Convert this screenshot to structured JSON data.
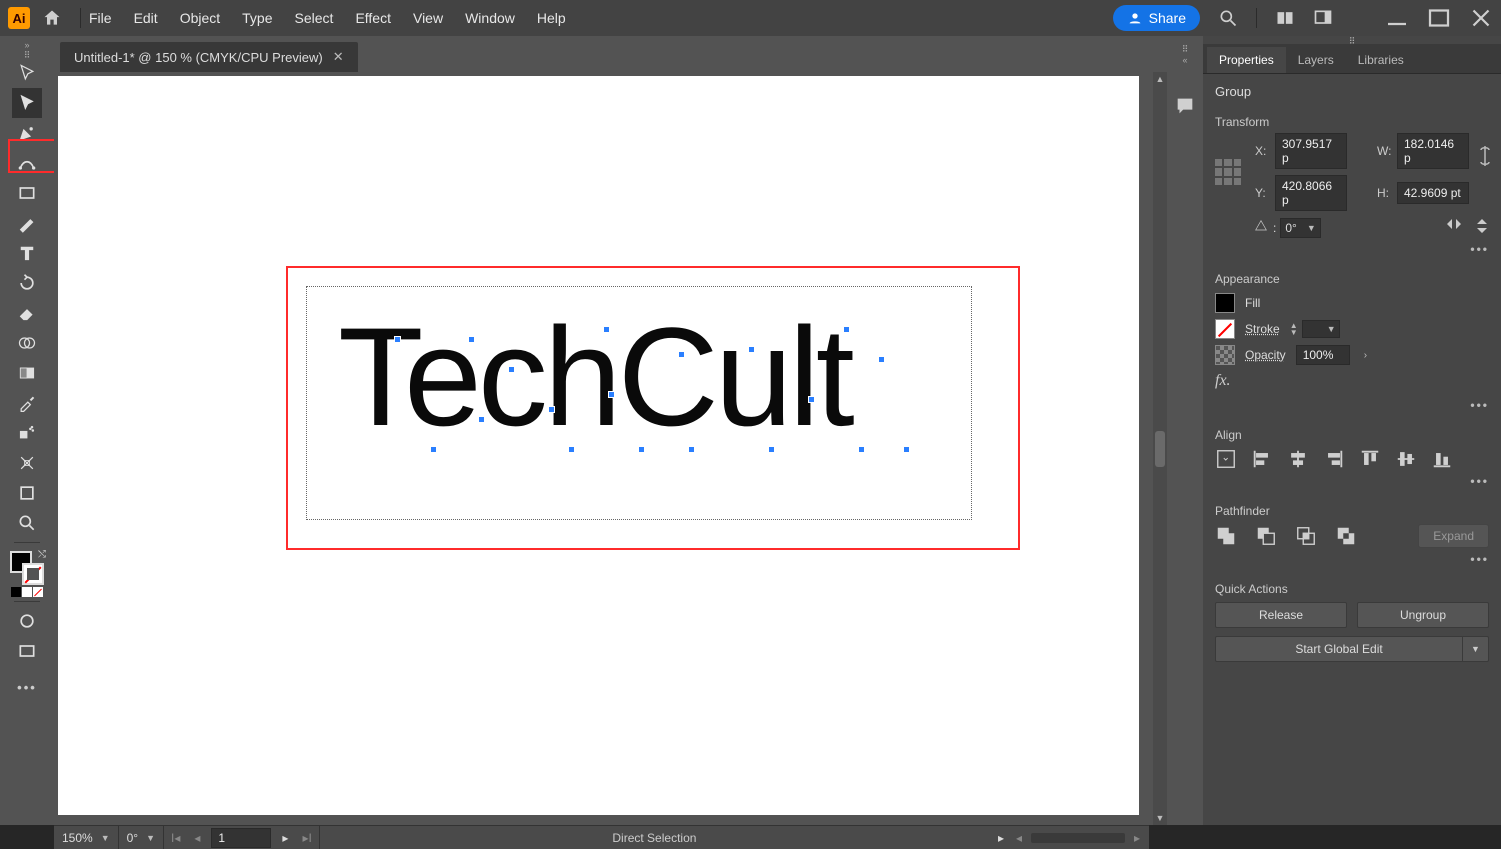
{
  "menu": {
    "items": [
      "File",
      "Edit",
      "Object",
      "Type",
      "Select",
      "Effect",
      "View",
      "Window",
      "Help"
    ]
  },
  "share_label": "Share",
  "doc_tab": {
    "label": "Untitled-1* @ 150 % (CMYK/CPU Preview)"
  },
  "canvas_text": "TechCult",
  "bottom": {
    "zoom": "150%",
    "rotate": "0°",
    "page": "1",
    "tool": "Direct Selection"
  },
  "properties": {
    "tabs": [
      "Properties",
      "Layers",
      "Libraries"
    ],
    "selection_type": "Group",
    "transform": {
      "section": "Transform",
      "x_label": "X:",
      "x": "307.9517 p",
      "y_label": "Y:",
      "y": "420.8066 p",
      "w_label": "W:",
      "w": "182.0146 p",
      "h_label": "H:",
      "h": "42.9609 pt",
      "angle": "0°"
    },
    "appearance": {
      "section": "Appearance",
      "fill_label": "Fill",
      "stroke_label": "Stroke",
      "opacity_label": "Opacity",
      "opacity": "100%",
      "fx_label": "fx."
    },
    "align": {
      "section": "Align"
    },
    "pathfinder": {
      "section": "Pathfinder",
      "expand_label": "Expand"
    },
    "quick_actions": {
      "section": "Quick Actions",
      "release": "Release",
      "ungroup": "Ungroup",
      "global_edit": "Start Global Edit"
    }
  }
}
